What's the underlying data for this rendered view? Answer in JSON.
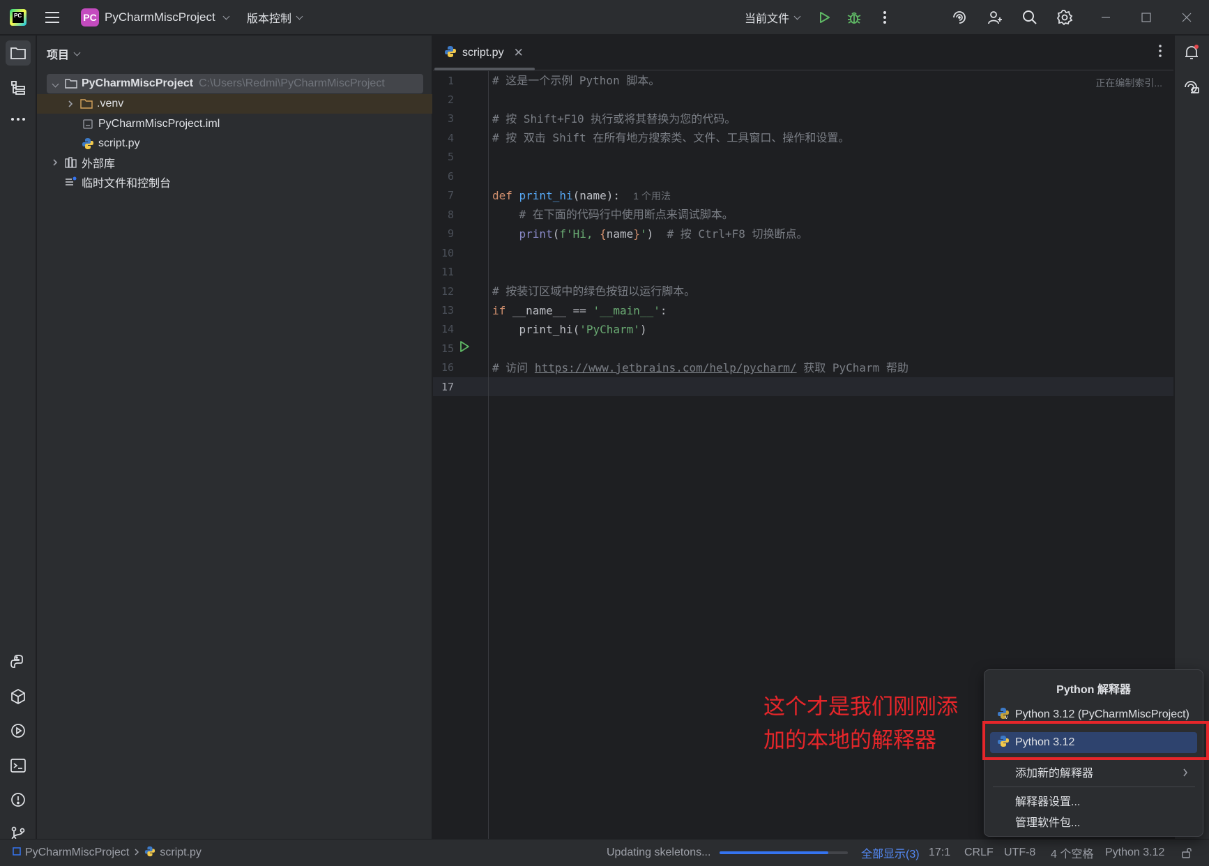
{
  "titlebar": {
    "project_badge": "PC",
    "project_name": "PyCharmMiscProject",
    "vcs_label": "版本控制",
    "run_config_label": "当前文件",
    "icons": [
      "hamburger-icon",
      "run-icon",
      "debug-icon",
      "more-icon",
      "ai-assistant-icon",
      "add-user-icon",
      "search-icon",
      "gear-icon",
      "minimize-icon",
      "maximize-icon",
      "close-icon"
    ]
  },
  "left_strip": {
    "icons": [
      "folder-icon",
      "structure-icon",
      "more-tools-icon",
      "python-console-icon",
      "python-packages-icon",
      "services-icon",
      "terminal-icon",
      "problems-icon",
      "git-icon"
    ]
  },
  "project_panel": {
    "title": "项目",
    "tree": {
      "root_name": "PyCharmMiscProject",
      "root_path": "C:\\Users\\Redmi\\PyCharmMiscProject",
      "venv": ".venv",
      "iml": "PyCharmMiscProject.iml",
      "script": "script.py",
      "external_libs": "外部库",
      "scratches": "临时文件和控制台"
    }
  },
  "editor": {
    "tab_label": "script.py",
    "indexing_status": "正在编制索引...",
    "current_line": 17,
    "line_numbers": [
      "1",
      "2",
      "3",
      "4",
      "5",
      "6",
      "7",
      "8",
      "9",
      "10",
      "11",
      "12",
      "13",
      "14",
      "15",
      "16",
      "17"
    ],
    "code": {
      "l1": "# 这是一个示例 Python 脚本。",
      "l3": "# 按 Shift+F10 执行或将其替换为您的代码。",
      "l4": "# 按 双击 Shift 在所有地方搜索类、文件、工具窗口、操作和设置。",
      "l7_kw": "def ",
      "l7_fn": "print_hi",
      "l7_rest": "(name):",
      "l7_hint": "1 个用法",
      "l8": "# 在下面的代码行中使用断点来调试脚本。",
      "l9_bi": "print",
      "l9_open": "(",
      "l9_str1": "f'Hi, ",
      "l9_brace1": "{",
      "l9_var": "name",
      "l9_brace2": "}",
      "l9_str2": "'",
      "l9_close": ")",
      "l9_cm": "# 按 Ctrl+F8 切换断点。",
      "l12": "# 按装订区域中的绿色按钮以运行脚本。",
      "l13_kw": "if ",
      "l13_mid": "__name__ == ",
      "l13_str": "'__main__'",
      "l13_end": ":",
      "l14_fn": "print_hi(",
      "l14_str": "'PyCharm'",
      "l14_end": ")",
      "l16_pre": "# 访问 ",
      "l16_link": "https://www.jetbrains.com/help/pycharm/",
      "l16_post": " 获取 PyCharm 帮助"
    }
  },
  "interpreter_popup": {
    "title": "Python 解释器",
    "items": [
      {
        "label": "Python 3.12 (PyCharmMiscProject)"
      },
      {
        "label": "Python 3.12",
        "selected": true
      },
      {
        "label": "添加新的解释器"
      },
      {
        "label": "解释器设置..."
      },
      {
        "label": "管理软件包..."
      }
    ]
  },
  "annotation": {
    "line1": "这个才是我们刚刚添",
    "line2": "加的本地的解释器",
    "color": "#e5262a"
  },
  "statusbar": {
    "breadcrumb_project": "PyCharmMiscProject",
    "breadcrumb_file": "script.py",
    "task": "Updating skeletons...",
    "progress": 0.85,
    "show_all": "全部显示(3)",
    "position": "17:1",
    "line_sep": "CRLF",
    "encoding": "UTF-8",
    "indent": "4 个空格",
    "interpreter": "Python 3.12"
  },
  "colors": {
    "accent": "#3574f0",
    "run_green": "#5fb865",
    "selection": "#2e436e"
  }
}
